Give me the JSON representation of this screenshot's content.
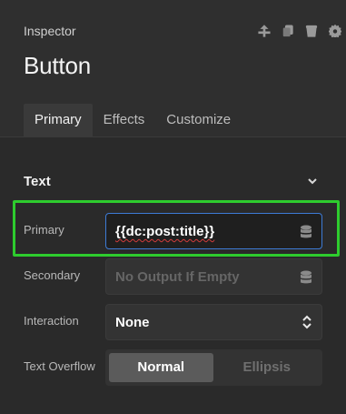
{
  "header": {
    "panel_label": "Inspector",
    "title": "Button",
    "tools": [
      {
        "name": "move-up-icon"
      },
      {
        "name": "copy-icon"
      },
      {
        "name": "delete-icon"
      },
      {
        "name": "settings-icon"
      }
    ]
  },
  "tabs": [
    {
      "label": "Primary",
      "active": true
    },
    {
      "label": "Effects",
      "active": false
    },
    {
      "label": "Customize",
      "active": false
    }
  ],
  "section": {
    "title": "Text"
  },
  "fields": {
    "primary": {
      "label": "Primary",
      "value": "{{dc:post:title}}"
    },
    "secondary": {
      "label": "Secondary",
      "placeholder": "No Output If Empty"
    },
    "interaction": {
      "label": "Interaction",
      "value": "None"
    },
    "text_overflow": {
      "label": "Text Overflow",
      "options": [
        "Normal",
        "Ellipsis"
      ],
      "selected": "Normal"
    }
  },
  "colors": {
    "focus_border": "#3d7bd6",
    "highlight": "#2ecc2e",
    "background": "#2b2b2b"
  }
}
